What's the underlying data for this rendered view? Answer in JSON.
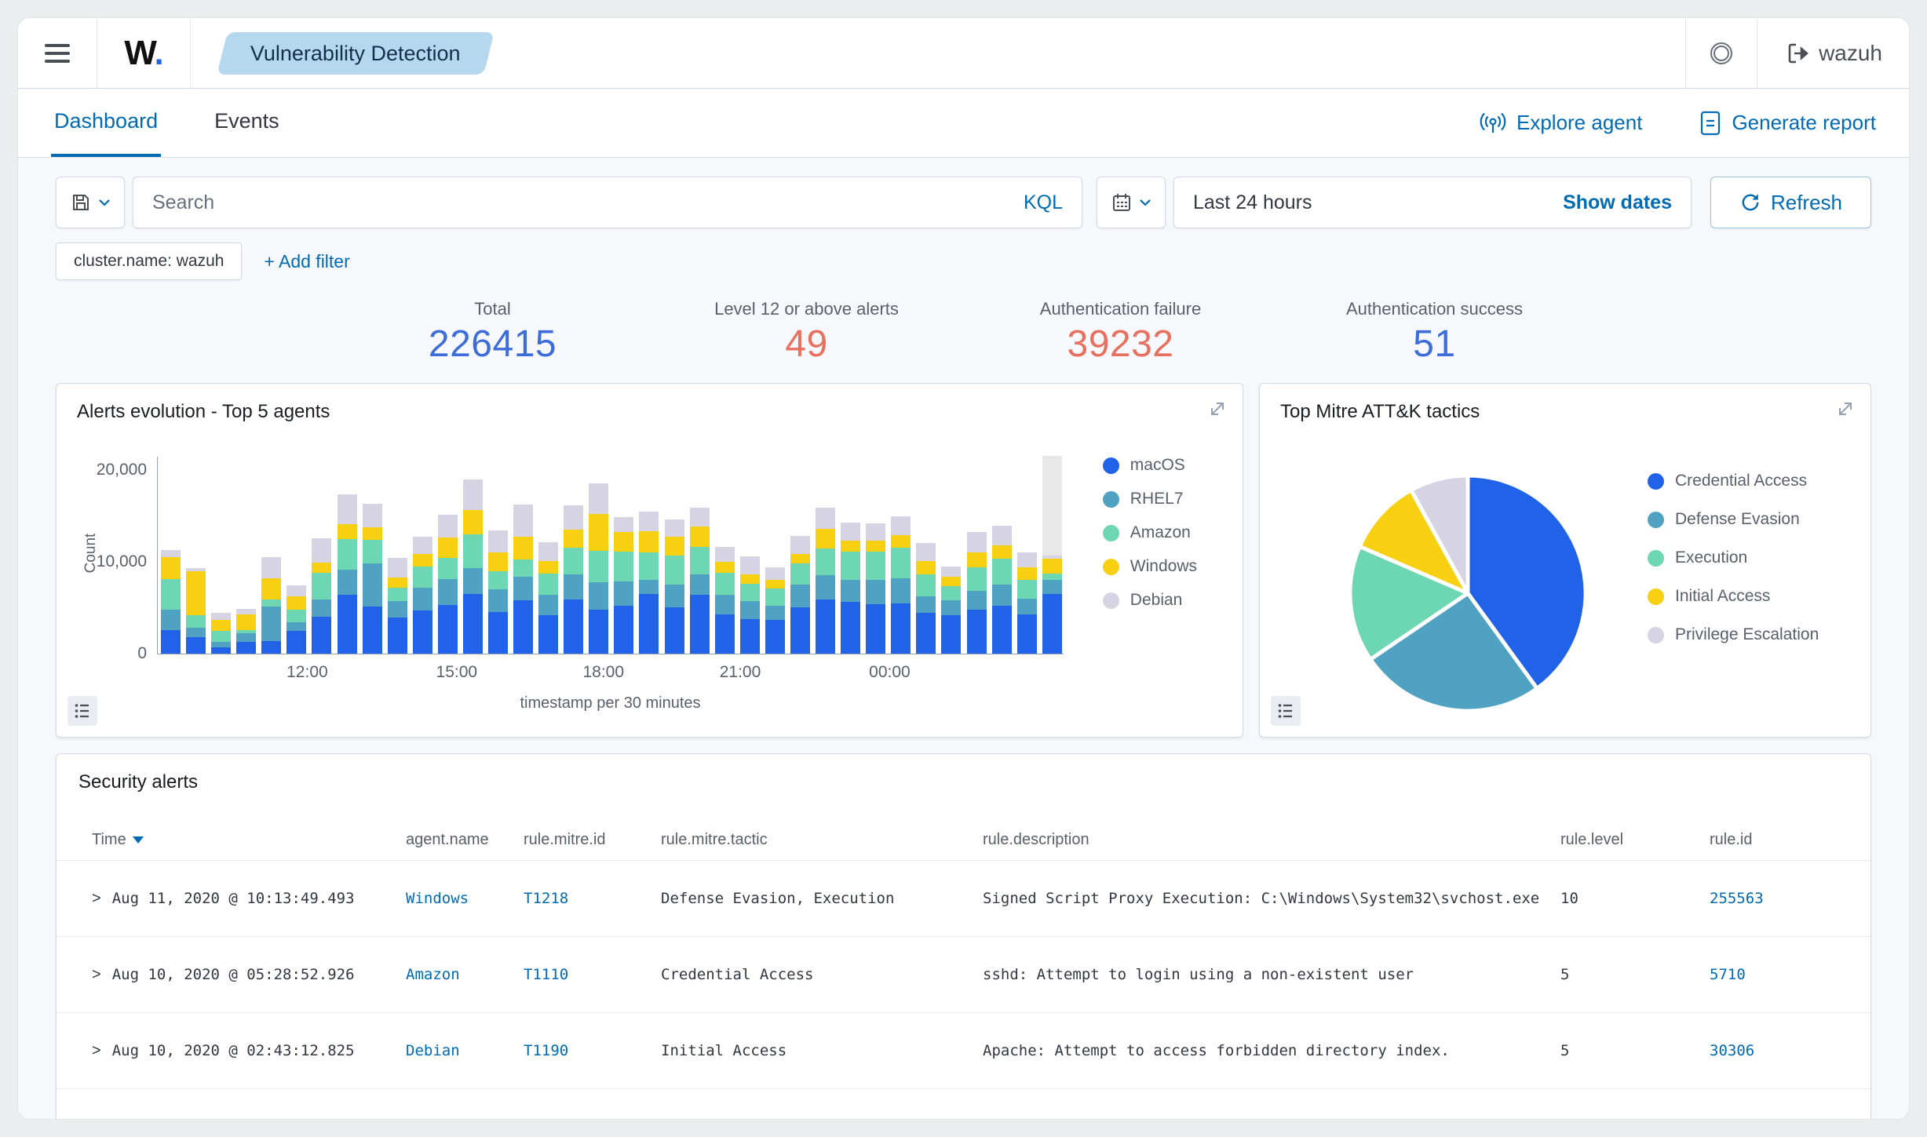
{
  "header": {
    "logo": "W",
    "logo_dot": ".",
    "breadcrumb": "Vulnerability Detection",
    "user": "wazuh"
  },
  "tabs": [
    {
      "label": "Dashboard",
      "active": true
    },
    {
      "label": "Events",
      "active": false
    }
  ],
  "actions": {
    "explore_agent": "Explore agent",
    "generate_report": "Generate report"
  },
  "query_bar": {
    "search_placeholder": "Search",
    "kql_label": "KQL",
    "time_range": "Last 24 hours",
    "show_dates_label": "Show dates",
    "refresh_label": "Refresh"
  },
  "filters": {
    "pill": "cluster.name: wazuh",
    "add_filter_label": "+ Add filter"
  },
  "metrics": [
    {
      "label": "Total",
      "value": "226415",
      "color": "#3D6DD8"
    },
    {
      "label": "Level 12 or above alerts",
      "value": "49",
      "color": "#E8705F"
    },
    {
      "label": "Authentication failure",
      "value": "39232",
      "color": "#E8705F"
    },
    {
      "label": "Authentication success",
      "value": "51",
      "color": "#3D6DD8"
    }
  ],
  "chart_data": [
    {
      "type": "bar",
      "stacked": true,
      "title": "Alerts evolution - Top 5 agents",
      "xlabel": "timestamp per 30 minutes",
      "ylabel": "Count",
      "ylim": [
        0,
        21500
      ],
      "yticks": [
        {
          "label": "0",
          "value": 0
        },
        {
          "label": "10,000",
          "value": 10000
        },
        {
          "label": "20,000",
          "value": 20000
        }
      ],
      "xticks": [
        {
          "label": "12:00",
          "pct": 16.5
        },
        {
          "label": "15:00",
          "pct": 33.0
        },
        {
          "label": "18:00",
          "pct": 49.2
        },
        {
          "label": "21:00",
          "pct": 64.3
        },
        {
          "label": "00:00",
          "pct": 80.8
        }
      ],
      "legend_position": "right",
      "series": [
        {
          "name": "macOS",
          "color": "#2163E8",
          "values": [
            2600,
            1800,
            700,
            1300,
            1400,
            2500,
            4000,
            6400,
            5100,
            3900,
            4700,
            5300,
            6500,
            4500,
            5800,
            4200,
            5900,
            4800,
            5200,
            6500,
            5000,
            6400,
            4300,
            3800,
            3700,
            5000,
            5900,
            5600,
            5400,
            5500,
            4400,
            4200,
            4800,
            5200,
            4300,
            6500
          ]
        },
        {
          "name": "RHEL7",
          "color": "#4FA2C1",
          "values": [
            2200,
            1000,
            600,
            900,
            3700,
            900,
            1900,
            2700,
            4700,
            1800,
            2500,
            2800,
            2800,
            2500,
            2600,
            2200,
            2700,
            3000,
            2700,
            1500,
            2500,
            2200,
            2100,
            1900,
            1500,
            2500,
            2600,
            2400,
            2600,
            2700,
            1800,
            1600,
            2000,
            2300,
            1700,
            1500
          ]
        },
        {
          "name": "Amazon",
          "color": "#6DD7B4",
          "values": [
            3300,
            1350,
            1200,
            400,
            800,
            1400,
            2900,
            3400,
            2600,
            1500,
            2300,
            2300,
            3700,
            2000,
            1800,
            2300,
            2900,
            3400,
            3200,
            3000,
            3200,
            3000,
            2400,
            1900,
            1900,
            2300,
            2900,
            3100,
            3100,
            3300,
            2400,
            1500,
            2600,
            2800,
            2000,
            700
          ]
        },
        {
          "name": "Windows",
          "color": "#F7D012",
          "values": [
            2400,
            4850,
            1200,
            1700,
            2300,
            1400,
            1100,
            1600,
            1300,
            1100,
            1300,
            2200,
            2600,
            2000,
            2500,
            1400,
            2000,
            4000,
            2100,
            2300,
            2000,
            2200,
            1200,
            1000,
            900,
            1000,
            2200,
            1200,
            1200,
            1400,
            1500,
            1100,
            1600,
            1500,
            1400,
            1600
          ]
        },
        {
          "name": "Debian",
          "color": "#D6D3E2",
          "values": [
            800,
            300,
            700,
            600,
            2300,
            1200,
            2600,
            3200,
            2600,
            2100,
            1900,
            2500,
            3300,
            2400,
            3500,
            2000,
            2600,
            3300,
            1700,
            2100,
            1900,
            2100,
            1600,
            2000,
            1400,
            2000,
            2300,
            2000,
            1900,
            2000,
            1900,
            1100,
            2200,
            2100,
            1600,
            400
          ]
        }
      ],
      "incomplete_bucket": {
        "bar_index": 35,
        "value": 10800,
        "color": "#E8E8E8"
      }
    },
    {
      "type": "pie",
      "title": "Top Mitre ATT&K tactics",
      "legend_position": "right",
      "slices": [
        {
          "label": "Credential Access",
          "pct": 40.0,
          "color": "#2163E8"
        },
        {
          "label": "Defense Evasion",
          "pct": 25.5,
          "color": "#4FA2C1"
        },
        {
          "label": "Execution",
          "pct": 16.0,
          "color": "#6DD7B4"
        },
        {
          "label": "Initial Access",
          "pct": 10.5,
          "color": "#F7D012"
        },
        {
          "label": "Privilege Escalation",
          "pct": 8.0,
          "color": "#D6D3E2"
        }
      ]
    }
  ],
  "table": {
    "title": "Security alerts",
    "columns": [
      "Time",
      "agent.name",
      "rule.mitre.id",
      "rule.mitre.tactic",
      "rule.description",
      "rule.level",
      "rule.id"
    ],
    "rows": [
      {
        "time": "Aug 11, 2020 @ 10:13:49.493",
        "agent": "Windows",
        "mitre_id": "T1218",
        "tactic": "Defense Evasion, Execution",
        "description": "Signed Script Proxy Execution: C:\\Windows\\System32\\svchost.exe",
        "level": "10",
        "rule_id": "255563"
      },
      {
        "time": "Aug 10, 2020 @ 05:28:52.926",
        "agent": "Amazon",
        "mitre_id": "T1110",
        "tactic": "Credential Access",
        "description": "sshd: Attempt to login using a non-existent user",
        "level": "5",
        "rule_id": "5710"
      },
      {
        "time": "Aug 10, 2020 @ 02:43:12.825",
        "agent": "Debian",
        "mitre_id": "T1190",
        "tactic": "Initial Access",
        "description": "Apache: Attempt to access forbidden directory index.",
        "level": "5",
        "rule_id": "30306"
      }
    ]
  }
}
